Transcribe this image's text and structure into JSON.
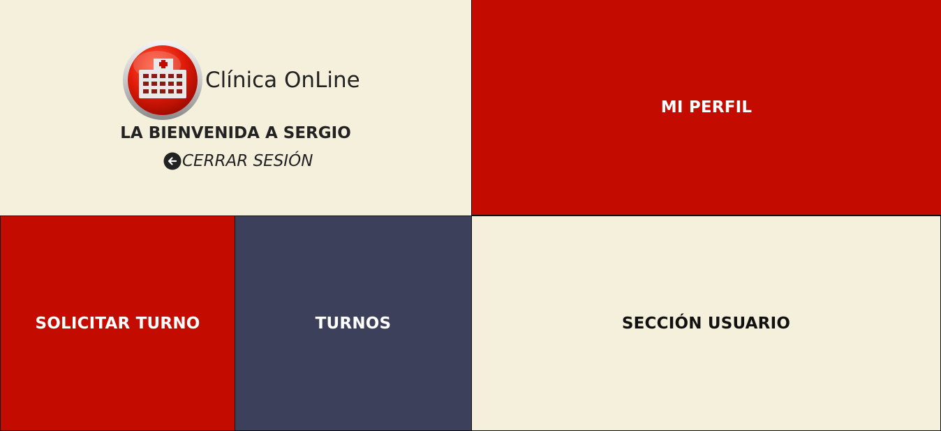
{
  "brand": {
    "title": "Clínica OnLine",
    "logo_icon": "hospital-icon"
  },
  "welcome": {
    "message": "LA BIENVENIDA A SERGIO"
  },
  "logout": {
    "icon": "arrow-left-circle-icon",
    "label": "CERRAR SESIÓN"
  },
  "tiles": {
    "perfil": "MI PERFIL",
    "solicitar_turno": "SOLICITAR TURNO",
    "turnos": "TURNOS",
    "seccion_usuario": "SECCIÓN USUARIO"
  },
  "colors": {
    "accent_red": "#c40b00",
    "navy": "#3d405b",
    "cream": "#f4f0dc"
  }
}
